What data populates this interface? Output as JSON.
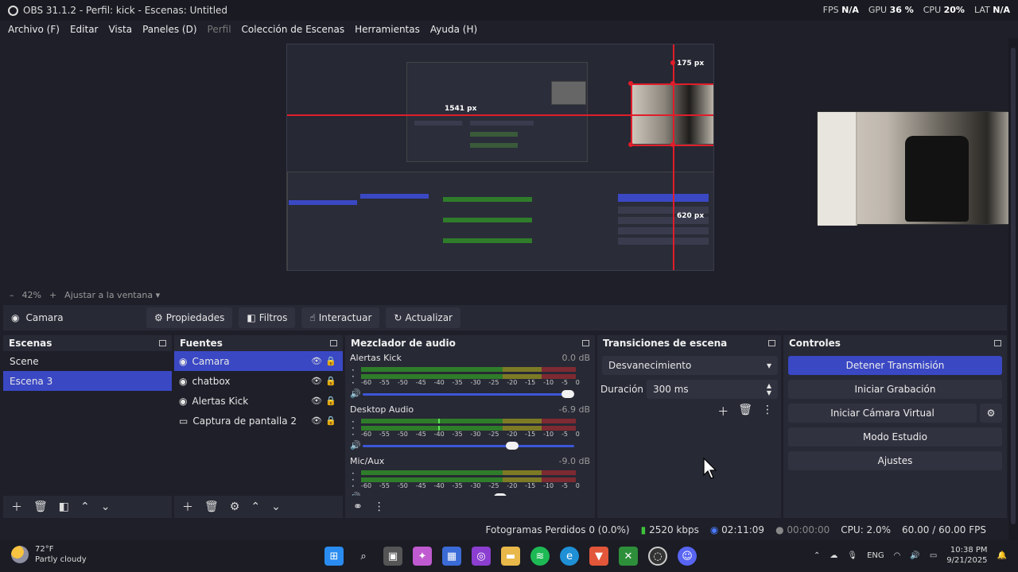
{
  "window": {
    "title": "OBS 31.1.2 - Perfil: kick - Escenas: Untitled",
    "stats": [
      {
        "label": "FPS",
        "value": "N/A"
      },
      {
        "label": "GPU",
        "value": "36 %"
      },
      {
        "label": "CPU",
        "value": "20%"
      },
      {
        "label": "LAT",
        "value": "N/A"
      }
    ]
  },
  "menu": [
    "Archivo (F)",
    "Editar",
    "Vista",
    "Paneles (D)",
    "Perfil",
    "Colección de Escenas",
    "Herramientas",
    "Ayuda (H)"
  ],
  "preview": {
    "labels": {
      "width_px": "1541 px",
      "top_px": "175 px",
      "right_px": "620 px"
    }
  },
  "zoom": {
    "minus": "–",
    "value": "42%",
    "plus": "+",
    "fit": "Ajustar a la ventana"
  },
  "source_toolbar": {
    "selected_source": "Camara",
    "buttons": [
      "Propiedades",
      "Filtros",
      "Interactuar",
      "Actualizar"
    ]
  },
  "docks": {
    "scenes": {
      "title": "Escenas",
      "items": [
        "Scene",
        "Escena 3"
      ],
      "selected": 1
    },
    "sources": {
      "title": "Fuentes",
      "items": [
        {
          "label": "Camara",
          "type": "camera"
        },
        {
          "label": "chatbox",
          "type": "browser"
        },
        {
          "label": "Alertas Kick",
          "type": "browser"
        },
        {
          "label": "Captura de pantalla 2",
          "type": "display"
        }
      ],
      "selected": 0
    },
    "mixer": {
      "title": "Mezclador de audio",
      "scale": [
        "-60",
        "-55",
        "-50",
        "-45",
        "-40",
        "-35",
        "-30",
        "-25",
        "-20",
        "-15",
        "-10",
        "-5",
        "0"
      ],
      "channels": [
        {
          "name": "Alertas Kick",
          "db": "0.0 dB",
          "fader": 1.0,
          "level": 0
        },
        {
          "name": "Desktop Audio",
          "db": "-6.9 dB",
          "fader": 0.72,
          "level": 0.36
        },
        {
          "name": "Mic/Aux",
          "db": "-9.0 dB",
          "fader": 0.66,
          "level": 0
        }
      ]
    },
    "transitions": {
      "title": "Transiciones de escena",
      "selected": "Desvanecimiento",
      "duration_label": "Duración",
      "duration_value": "300 ms"
    },
    "controls": {
      "title": "Controles",
      "buttons": [
        "Detener Transmisión",
        "Iniciar Grabación",
        "Iniciar Cámara Virtual",
        "Modo Estudio",
        "Ajustes"
      ]
    }
  },
  "status": {
    "dropped": "Fotogramas Perdidos 0 (0.0%)",
    "bitrate": "2520 kbps",
    "stream_time": "02:11:09",
    "rec_time": "00:00:00",
    "cpu": "CPU: 2.0%",
    "fps": "60.00 / 60.00 FPS"
  },
  "taskbar": {
    "weather_temp": "72°F",
    "weather_desc": "Partly cloudy",
    "lang": "ENG",
    "time": "10:38 PM",
    "date": "9/21/2025"
  },
  "colors": {
    "accent": "#3a48c4",
    "guide": "#e11d2a",
    "meter_green": "#2f7d2a",
    "meter_yellow": "#7d7a26",
    "meter_red": "#7d2a32"
  }
}
